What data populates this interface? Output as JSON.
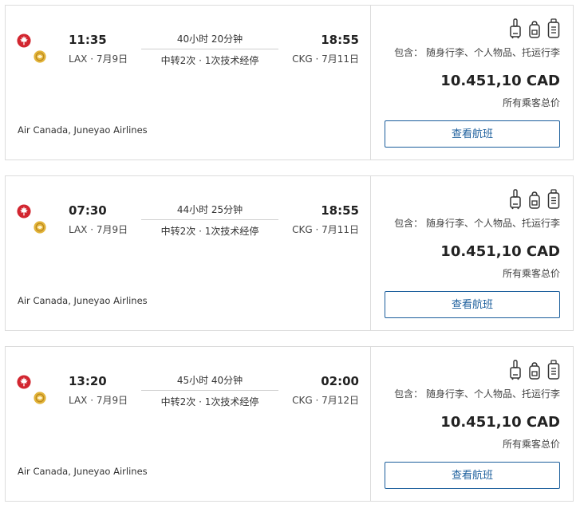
{
  "colors": {
    "accent": "#1b5e9c",
    "air_canada_red": "#d22630",
    "juneyao_gold": "#e3b53b"
  },
  "flights": [
    {
      "dep_time": "11:35",
      "dep_info": "LAX · 7月9日",
      "duration": "40小时 20分钟",
      "stops": "中转2次 · 1次技术经停",
      "arr_time": "18:55",
      "arr_info": "CKG · 7月11日",
      "airlines": "Air Canada, Juneyao Airlines",
      "includes": "包含：  随身行李、个人物品、托运行李",
      "price": "10.451,10 CAD",
      "price_note": "所有乘客总价",
      "button": "查看航班"
    },
    {
      "dep_time": "07:30",
      "dep_info": "LAX · 7月9日",
      "duration": "44小时 25分钟",
      "stops": "中转2次 · 1次技术经停",
      "arr_time": "18:55",
      "arr_info": "CKG · 7月11日",
      "airlines": "Air Canada, Juneyao Airlines",
      "includes": "包含：  随身行李、个人物品、托运行李",
      "price": "10.451,10 CAD",
      "price_note": "所有乘客总价",
      "button": "查看航班"
    },
    {
      "dep_time": "13:20",
      "dep_info": "LAX · 7月9日",
      "duration": "45小时 40分钟",
      "stops": "中转2次 · 1次技术经停",
      "arr_time": "02:00",
      "arr_info": "CKG · 7月12日",
      "airlines": "Air Canada, Juneyao Airlines",
      "includes": "包含：  随身行李、个人物品、托运行李",
      "price": "10.451,10 CAD",
      "price_note": "所有乘客总价",
      "button": "查看航班"
    }
  ]
}
